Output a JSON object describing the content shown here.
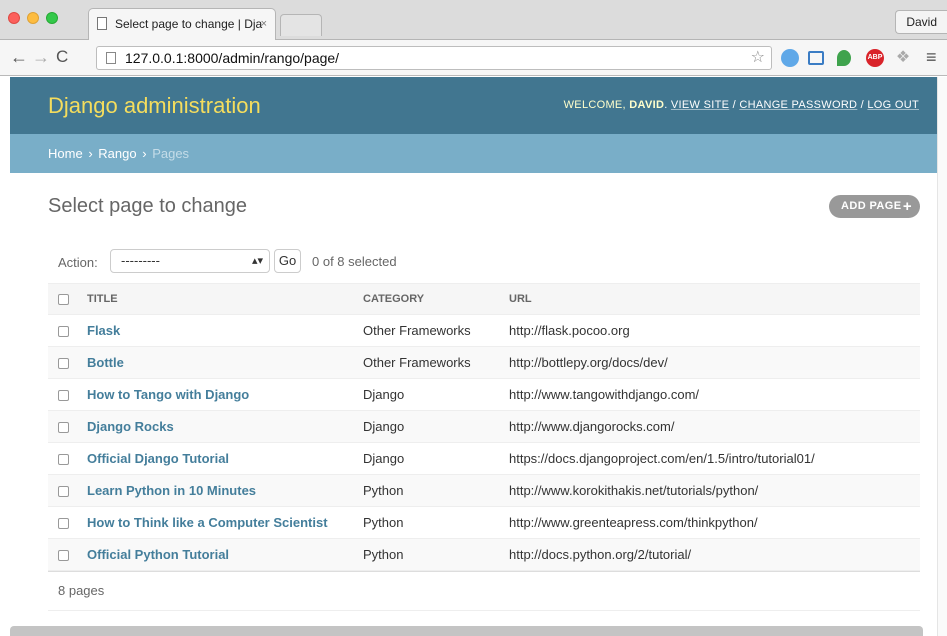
{
  "browser": {
    "tab_title": "Select page to change | Dja",
    "tab_close": "×",
    "profile_name": "David",
    "url_host": "127.0.0.1",
    "url_path": ":8000/admin/rango/page/",
    "extensions": [
      "snowflake-icon",
      "screenshot-icon",
      "evernote-icon",
      "adblock-icon",
      "dropbox-icon"
    ],
    "adblock_label": "ABP"
  },
  "header": {
    "site_title": "Django administration",
    "welcome": "Welcome,",
    "username": "David",
    "view_site": "View site",
    "change_password": "Change password",
    "log_out": "Log out"
  },
  "breadcrumbs": {
    "home": "Home",
    "app": "Rango",
    "current": "Pages",
    "separator": "›"
  },
  "content": {
    "title": "Select page to change",
    "add_button": "ADD PAGE"
  },
  "actions": {
    "label": "Action:",
    "selected_option": "---------",
    "go": "Go",
    "counter": "0 of 8 selected"
  },
  "table": {
    "columns": [
      "Title",
      "Category",
      "URL"
    ],
    "rows": [
      {
        "title": "Flask",
        "category": "Other Frameworks",
        "url": "http://flask.pocoo.org"
      },
      {
        "title": "Bottle",
        "category": "Other Frameworks",
        "url": "http://bottlepy.org/docs/dev/"
      },
      {
        "title": "How to Tango with Django",
        "category": "Django",
        "url": "http://www.tangowithdjango.com/"
      },
      {
        "title": "Django Rocks",
        "category": "Django",
        "url": "http://www.djangorocks.com/"
      },
      {
        "title": "Official Django Tutorial",
        "category": "Django",
        "url": "https://docs.djangoproject.com/en/1.5/intro/tutorial01/"
      },
      {
        "title": "Learn Python in 10 Minutes",
        "category": "Python",
        "url": "http://www.korokithakis.net/tutorials/python/"
      },
      {
        "title": "How to Think like a Computer Scientist",
        "category": "Python",
        "url": "http://www.greenteapress.com/thinkpython/"
      },
      {
        "title": "Official Python Tutorial",
        "category": "Python",
        "url": "http://docs.python.org/2/tutorial/"
      }
    ]
  },
  "paginator": {
    "text": "8 pages"
  },
  "colors": {
    "header_bg": "#417690",
    "breadcrumbs_bg": "#79aec8",
    "site_title": "#f5dd5d",
    "link": "#447e9b"
  }
}
